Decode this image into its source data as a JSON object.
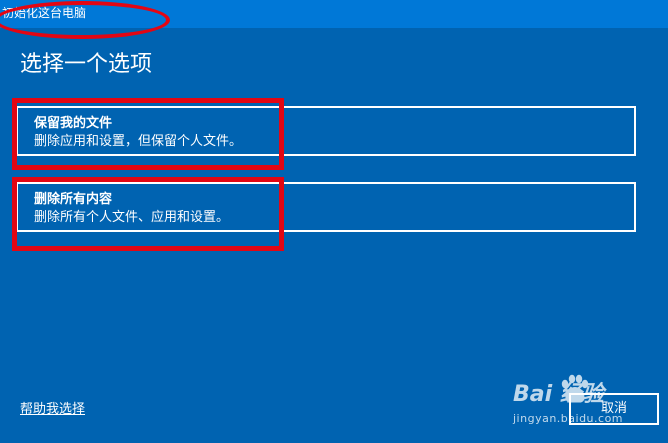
{
  "window": {
    "title": "初始化这台电脑"
  },
  "page": {
    "title": "选择一个选项"
  },
  "options": [
    {
      "title": "保留我的文件",
      "description": "删除应用和设置，但保留个人文件。"
    },
    {
      "title": "删除所有内容",
      "description": "删除所有个人文件、应用和设置。"
    }
  ],
  "footer": {
    "help_link": "帮助我选择",
    "cancel_label": "取消"
  },
  "watermark": {
    "logo": "Bai 经验",
    "url": "jingyan.baidu.com"
  },
  "colors": {
    "background": "#0063b1",
    "titlebar": "#0078d7",
    "annotation": "#e30613"
  }
}
